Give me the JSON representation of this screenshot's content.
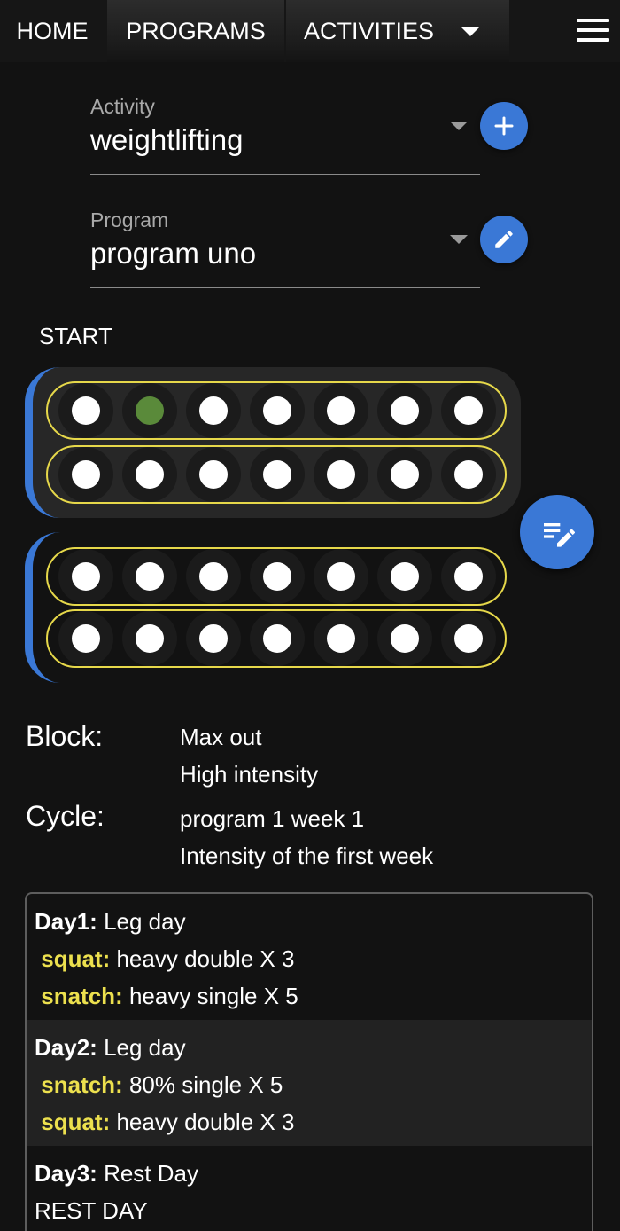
{
  "nav": {
    "tabs": [
      "HOME",
      "PROGRAMS",
      "ACTIVITIES"
    ],
    "menu_icon": "hamburger-menu-icon"
  },
  "activity": {
    "label": "Activity",
    "value": "weightlifting",
    "action_icon": "plus-icon"
  },
  "program": {
    "label": "Program",
    "value": "program uno",
    "action_icon": "pencil-icon"
  },
  "start_label": "START",
  "weeks": [
    {
      "rows": [
        [
          0,
          1,
          0,
          0,
          0,
          0,
          0
        ],
        [
          0,
          0,
          0,
          0,
          0,
          0,
          0
        ]
      ]
    },
    {
      "rows": [
        [
          0,
          0,
          0,
          0,
          0,
          0,
          0
        ],
        [
          0,
          0,
          0,
          0,
          0,
          0,
          0
        ]
      ]
    }
  ],
  "fab_icon": "edit-list-icon",
  "info": {
    "block_label": "Block:",
    "block_name": "Max out",
    "block_desc": "High intensity",
    "cycle_label": "Cycle:",
    "cycle_name": "program 1 week 1",
    "cycle_desc": "Intensity of the first week"
  },
  "days": [
    {
      "title": "Day1:",
      "name": "Leg day",
      "exercises": [
        {
          "name": "squat:",
          "detail": "heavy double X 3"
        },
        {
          "name": "snatch:",
          "detail": "heavy single X 5"
        }
      ]
    },
    {
      "title": "Day2:",
      "name": "Leg day",
      "exercises": [
        {
          "name": "snatch:",
          "detail": "80% single X 5"
        },
        {
          "name": "squat:",
          "detail": "heavy double X 3"
        }
      ]
    },
    {
      "title": "Day3:",
      "name": "Rest Day",
      "note": "REST DAY"
    }
  ],
  "colors": {
    "accent": "#3a78d6",
    "row_border": "#e6d84a",
    "done": "#5a8a3a",
    "exercise": "#ece04e"
  }
}
